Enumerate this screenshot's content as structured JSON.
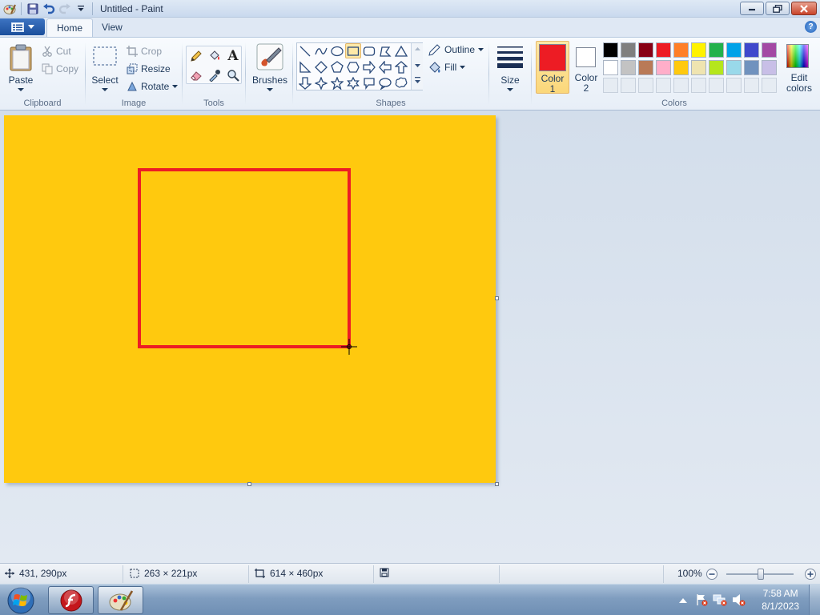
{
  "window": {
    "title": "Untitled - Paint"
  },
  "tabs": [
    {
      "label": "Home"
    },
    {
      "label": "View"
    }
  ],
  "help_label": "?",
  "clipboard": {
    "paste": "Paste",
    "cut": "Cut",
    "copy": "Copy",
    "group": "Clipboard"
  },
  "image": {
    "select": "Select",
    "crop": "Crop",
    "resize": "Resize",
    "rotate": "Rotate",
    "group": "Image"
  },
  "tools": {
    "group": "Tools",
    "text_glyph": "A"
  },
  "brushes": {
    "label": "Brushes"
  },
  "shapes": {
    "outline": "Outline",
    "fill": "Fill",
    "group": "Shapes"
  },
  "size": {
    "label": "Size"
  },
  "colors": {
    "color1_line1": "Color",
    "color1_line2": "1",
    "color2_line1": "Color",
    "color2_line2": "2",
    "edit_line1": "Edit",
    "edit_line2": "colors",
    "group": "Colors",
    "color1_value": "#ed1c24",
    "color2_value": "#ffffff",
    "palette_row1": [
      "#000000",
      "#7f7f7f",
      "#880015",
      "#ed1c24",
      "#ff7f27",
      "#fff200",
      "#22b14c",
      "#00a2e8",
      "#3f48cc",
      "#a349a4"
    ],
    "palette_row2": [
      "#ffffff",
      "#c3c3c3",
      "#b97a57",
      "#ffaec9",
      "#ffc90e",
      "#efe4b0",
      "#b5e61d",
      "#99d9ea",
      "#7092be",
      "#c8bfe7"
    ]
  },
  "canvas": {
    "background": "#ffc90e",
    "shape_stroke": "#ed1c24"
  },
  "status": {
    "cursor_pos": "431, 290px",
    "selection_size": "263 × 221px",
    "canvas_size": "614 × 460px",
    "zoom": "100%",
    "zoom_level": 1.0
  },
  "taskbar": {
    "time": "7:58 AM",
    "date": "8/1/2023"
  }
}
